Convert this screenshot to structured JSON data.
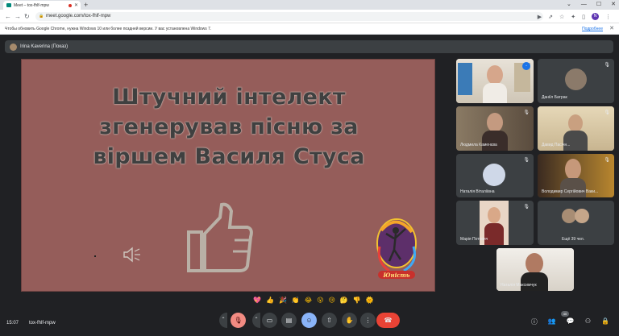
{
  "browser": {
    "tab_title": "Meet – tox-fhlf-mpw",
    "url": "meet.google.com/tox-fhlf-mpw",
    "profile_initial": "N",
    "info_message": "Чтобы обновить Google Chrome, нужна Windows 10 или более поздней версии. У вас установлена Windows 7.",
    "info_link": "Подробнее"
  },
  "meet": {
    "presenter_name": "Irina Kaverina (Показ)",
    "slide_title_lines": [
      "Штучний інтелект",
      "згенерував  пісню за",
      "віршем Василя Стуса"
    ],
    "logo_text": "Юність",
    "participants": [
      {
        "name": "",
        "self": true
      },
      {
        "name": "Даніїл Батрак"
      },
      {
        "name": "Людмила Каменєва"
      },
      {
        "name": "Давид Пасічн..."
      },
      {
        "name": "Наталія Віталіївна"
      },
      {
        "name": "Володимир Сергійович Ваки..."
      },
      {
        "name": "Марія Потович"
      },
      {
        "name": "Ещё 39 чел."
      },
      {
        "name": "Наталія Максимчук"
      }
    ],
    "reactions": [
      "💖",
      "👍",
      "🎉",
      "👏",
      "😂",
      "😮",
      "😢",
      "🤔",
      "👎",
      "🌞"
    ],
    "time": "15:07",
    "meeting_code": "tox-fhlf-mpw",
    "people_count": "40"
  }
}
